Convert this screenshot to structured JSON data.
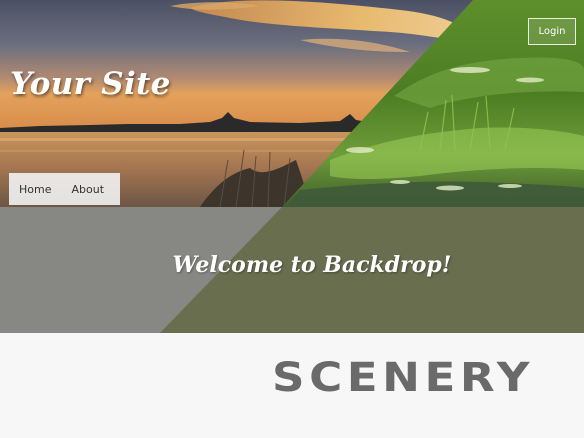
{
  "header": {
    "site_name": "Your Site",
    "login_label": "Login"
  },
  "nav": {
    "items": [
      {
        "label": "Home"
      },
      {
        "label": "About"
      }
    ]
  },
  "welcome": {
    "title": "Welcome to Backdrop!"
  },
  "scenery": {
    "title": "SCENERY"
  },
  "colors": {
    "sunset_sky_top": "#5a5e72",
    "sunset_horizon": "#e8a45c",
    "greenery": "#5f8f2a",
    "welcome_gray": "#878783",
    "welcome_olive": "#696e4f",
    "scenery_text": "#6a6a6a"
  }
}
